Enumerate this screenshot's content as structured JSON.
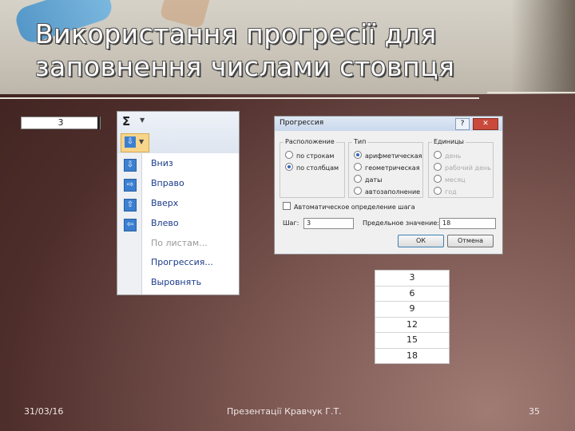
{
  "slide": {
    "title_line1": "Використання прогресії для",
    "title_line2": "заповнення числами стовпця"
  },
  "cell": {
    "value": "3"
  },
  "fill_menu": {
    "sigma": "Σ",
    "items": [
      {
        "label": "Вниз",
        "icon": "arrow-down-icon",
        "glyph": "⇩",
        "enabled": true
      },
      {
        "label": "Вправо",
        "icon": "arrow-right-icon",
        "glyph": "⇨",
        "enabled": true
      },
      {
        "label": "Вверх",
        "icon": "arrow-up-icon",
        "glyph": "⇧",
        "enabled": true
      },
      {
        "label": "Влево",
        "icon": "arrow-left-icon",
        "glyph": "⇦",
        "enabled": true
      },
      {
        "label": "По листам...",
        "enabled": false
      },
      {
        "label": "Прогрессия...",
        "enabled": true
      },
      {
        "label": "Выровнять",
        "enabled": true
      }
    ]
  },
  "dialog": {
    "title": "Прогрессия",
    "help": "?",
    "close": "✕",
    "location_label": "Расположение",
    "location_options": [
      "по строкам",
      "по столбцам"
    ],
    "location_selected": "по столбцам",
    "type_label": "Тип",
    "type_options": [
      "арифметическая",
      "геометрическая",
      "даты",
      "автозаполнение"
    ],
    "type_selected": "арифметическая",
    "units_label": "Единицы",
    "units_options": [
      "день",
      "рабочий день",
      "месяц",
      "год"
    ],
    "auto_step_label": "Автоматическое определение шага",
    "step_label": "Шаг:",
    "step_value": "3",
    "limit_label": "Предельное значение:",
    "limit_value": "18",
    "ok_label": "ОК",
    "cancel_label": "Отмена"
  },
  "result_column": [
    "3",
    "6",
    "9",
    "12",
    "15",
    "18"
  ],
  "footer": {
    "date": "31/03/16",
    "author": "Презентації Кравчук Г.Т.",
    "page": "35"
  },
  "colors": {
    "background": "#5a3835",
    "header": "#cfcac0",
    "dialog_title": "#c9d8ec",
    "close_button": "#c94a3b"
  }
}
